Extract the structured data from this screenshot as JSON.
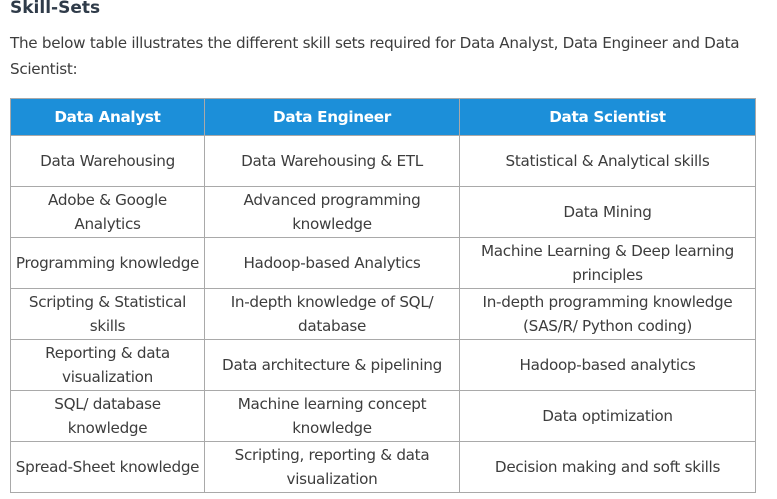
{
  "heading": "Skill-Sets",
  "intro": "The below table illustrates the different skill sets required for Data Analyst, Data Engineer and Data Scientist:",
  "table": {
    "headers": [
      "Data Analyst",
      "Data Engineer",
      "Data Scientist"
    ],
    "rows": [
      [
        "Data Warehousing",
        "Data Warehousing & ETL",
        "Statistical & Analytical skills"
      ],
      [
        "Adobe & Google Analytics",
        "Advanced programming knowledge",
        "Data Mining"
      ],
      [
        "Programming knowledge",
        "Hadoop-based Analytics",
        "Machine Learning & Deep learning principles"
      ],
      [
        "Scripting & Statistical skills",
        "In-depth knowledge of SQL/ database",
        "In-depth programming knowledge (SAS/R/ Python coding)"
      ],
      [
        "Reporting & data visualization",
        "Data architecture & pipelining",
        "Hadoop-based analytics"
      ],
      [
        "SQL/ database knowledge",
        "Machine learning concept knowledge",
        "Data optimization"
      ],
      [
        "Spread-Sheet knowledge",
        "Scripting, reporting & data visualization",
        "Decision making and soft skills"
      ]
    ]
  },
  "colors": {
    "header_bg": "#1c8fd9",
    "header_text": "#ffffff",
    "border": "#a9a9a9",
    "body_text": "#3d3d3d",
    "heading_text": "#2f3b49"
  }
}
